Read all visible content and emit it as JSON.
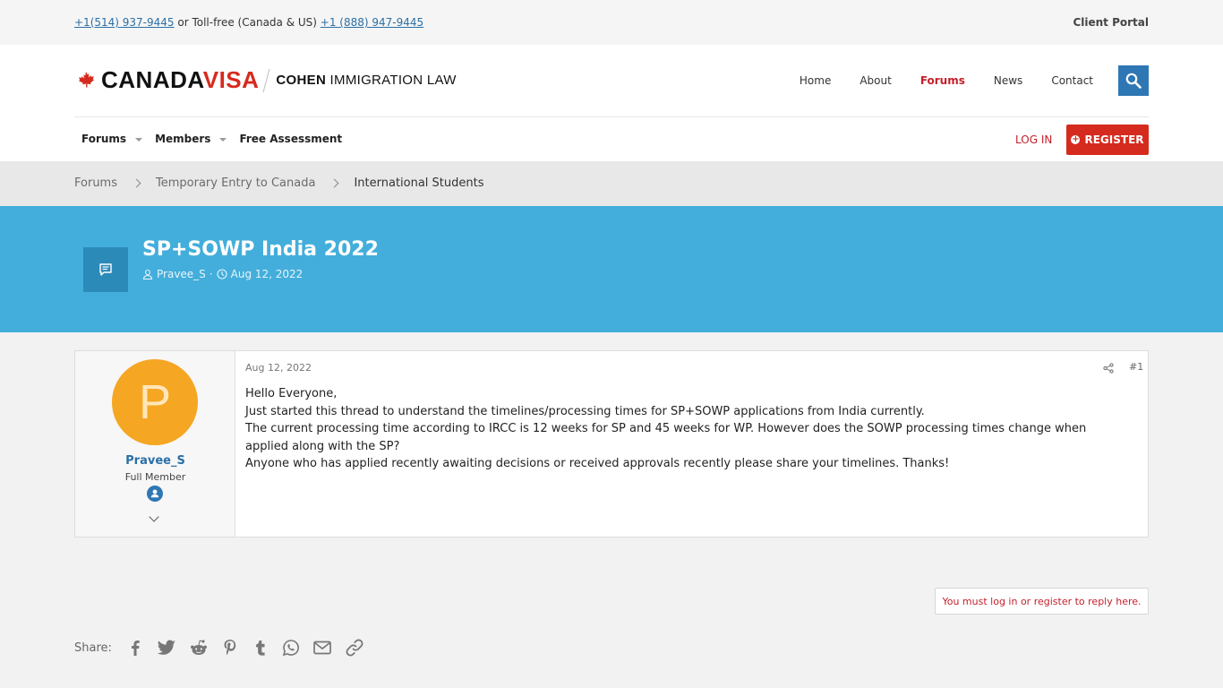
{
  "topbar": {
    "phone1": "+1(514) 937-9445",
    "or_text": " or Toll-free (Canada & US) ",
    "phone2": "+1 (888) 947-9445",
    "client_portal": "Client Portal"
  },
  "logo": {
    "brand_part1": "CANADA",
    "brand_part2": "VISA",
    "cohen_bold": "COHEN",
    "cohen_rest": " IMMIGRATION LAW"
  },
  "main_nav": [
    "Home",
    "About",
    "Forums",
    "News",
    "Contact"
  ],
  "main_nav_active": "Forums",
  "sub_nav": {
    "forums": "Forums",
    "members": "Members",
    "assessment": "Free Assessment"
  },
  "auth": {
    "login": "LOG IN",
    "register": "REGISTER"
  },
  "breadcrumb": [
    "Forums",
    "Temporary Entry to Canada",
    "International Students"
  ],
  "thread": {
    "title": "SP+SOWP India 2022",
    "author": "Pravee_S",
    "date": "Aug 12, 2022"
  },
  "post": {
    "date": "Aug 12, 2022",
    "number": "#1",
    "user": {
      "initial": "P",
      "name": "Pravee_S",
      "title": "Full Member"
    },
    "lines": [
      "Hello Everyone,",
      "Just started this thread to understand the timelines/processing times for SP+SOWP applications from India currently.",
      "The current processing time according to IRCC is 12 weeks for SP and 45 weeks for WP. However does the SOWP processing times change when applied along with the SP?",
      "Anyone who has applied recently awaiting decisions or received approvals recently please share your timelines. Thanks!"
    ]
  },
  "reply_notice": "You must log in or register to reply here.",
  "share": {
    "label": "Share:",
    "icons": [
      "facebook-icon",
      "twitter-icon",
      "reddit-icon",
      "pinterest-icon",
      "tumblr-icon",
      "whatsapp-icon",
      "email-icon",
      "link-icon"
    ]
  },
  "colors": {
    "brand_red": "#d52b1e",
    "banner_blue": "#43aedb",
    "link_blue": "#2b6fa6",
    "avatar_orange": "#f5a623"
  }
}
